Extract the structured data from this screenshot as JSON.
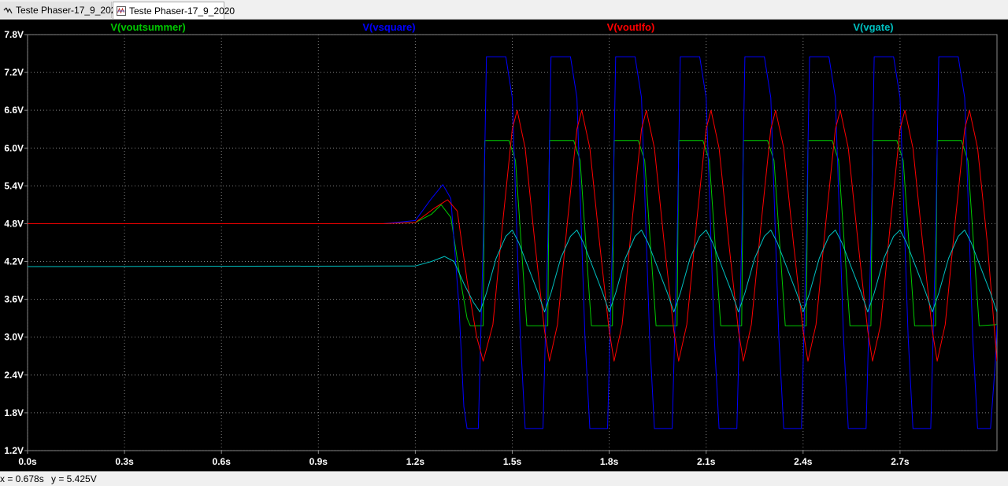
{
  "tabs": [
    {
      "label": "Teste Phaser-17_9_2020",
      "icon": "schematic-icon"
    },
    {
      "label": "Teste Phaser-17_9_2020",
      "icon": "waveform-icon",
      "active": true
    }
  ],
  "status": {
    "x_readout": "x = 0.678s",
    "y_readout": "y = 5.425V"
  },
  "chart_data": {
    "type": "line",
    "background": "#000000",
    "grid": true,
    "xlim": [
      0,
      3.0
    ],
    "ylim": [
      1.2,
      7.8
    ],
    "x_ticks": [
      0.0,
      0.3,
      0.6,
      0.9,
      1.2,
      1.5,
      1.8,
      2.1,
      2.4,
      2.7
    ],
    "x_tick_labels": [
      "0.0s",
      "0.3s",
      "0.6s",
      "0.9s",
      "1.2s",
      "1.5s",
      "1.8s",
      "2.1s",
      "2.4s",
      "2.7s"
    ],
    "y_ticks": [
      1.2,
      1.8,
      2.4,
      3.0,
      3.6,
      4.2,
      4.8,
      5.4,
      6.0,
      6.6,
      7.2,
      7.8
    ],
    "y_tick_labels": [
      "1.2V",
      "1.8V",
      "2.4V",
      "3.0V",
      "3.6V",
      "4.2V",
      "4.8V",
      "5.4V",
      "6.0V",
      "6.6V",
      "7.2V",
      "7.8V"
    ],
    "series": [
      {
        "name": "V(voutsummer)",
        "color": "#00c800",
        "points": [
          [
            0,
            4.8
          ],
          [
            1.1,
            4.8
          ],
          [
            1.2,
            4.82
          ],
          [
            1.25,
            4.95
          ],
          [
            1.28,
            5.1
          ],
          [
            1.31,
            4.9
          ],
          [
            1.34,
            3.9
          ],
          [
            1.36,
            3.3
          ],
          [
            1.37,
            3.18
          ],
          [
            1.41,
            3.18
          ],
          [
            1.415,
            6.12
          ],
          [
            1.49,
            6.12
          ],
          [
            1.51,
            5.8
          ],
          [
            1.545,
            3.18
          ],
          [
            1.61,
            3.18
          ],
          [
            1.615,
            6.12
          ],
          [
            1.69,
            6.12
          ],
          [
            1.71,
            5.8
          ],
          [
            1.745,
            3.18
          ],
          [
            1.81,
            3.18
          ],
          [
            1.815,
            6.12
          ],
          [
            1.89,
            6.12
          ],
          [
            1.91,
            5.8
          ],
          [
            1.945,
            3.18
          ],
          [
            2.01,
            3.18
          ],
          [
            2.015,
            6.12
          ],
          [
            2.09,
            6.12
          ],
          [
            2.11,
            5.8
          ],
          [
            2.145,
            3.18
          ],
          [
            2.21,
            3.18
          ],
          [
            2.215,
            6.12
          ],
          [
            2.29,
            6.12
          ],
          [
            2.31,
            5.8
          ],
          [
            2.345,
            3.18
          ],
          [
            2.41,
            3.18
          ],
          [
            2.415,
            6.12
          ],
          [
            2.49,
            6.12
          ],
          [
            2.51,
            5.8
          ],
          [
            2.545,
            3.18
          ],
          [
            2.61,
            3.18
          ],
          [
            2.615,
            6.12
          ],
          [
            2.69,
            6.12
          ],
          [
            2.71,
            5.8
          ],
          [
            2.745,
            3.18
          ],
          [
            2.81,
            3.18
          ],
          [
            2.815,
            6.12
          ],
          [
            2.89,
            6.12
          ],
          [
            2.91,
            5.8
          ],
          [
            2.945,
            3.18
          ],
          [
            3.0,
            3.2
          ]
        ]
      },
      {
        "name": "V(vsquare)",
        "color": "#0000ff",
        "points": [
          [
            0,
            4.8
          ],
          [
            1.1,
            4.8
          ],
          [
            1.2,
            4.85
          ],
          [
            1.25,
            5.2
          ],
          [
            1.285,
            5.42
          ],
          [
            1.31,
            5.2
          ],
          [
            1.335,
            3.5
          ],
          [
            1.35,
            1.9
          ],
          [
            1.36,
            1.55
          ],
          [
            1.395,
            1.55
          ],
          [
            1.41,
            4.5
          ],
          [
            1.42,
            7.45
          ],
          [
            1.48,
            7.45
          ],
          [
            1.5,
            6.8
          ],
          [
            1.525,
            3.0
          ],
          [
            1.54,
            1.55
          ],
          [
            1.595,
            1.55
          ],
          [
            1.61,
            4.5
          ],
          [
            1.62,
            7.45
          ],
          [
            1.68,
            7.45
          ],
          [
            1.7,
            6.8
          ],
          [
            1.725,
            3.0
          ],
          [
            1.74,
            1.55
          ],
          [
            1.795,
            1.55
          ],
          [
            1.81,
            4.5
          ],
          [
            1.82,
            7.45
          ],
          [
            1.88,
            7.45
          ],
          [
            1.9,
            6.8
          ],
          [
            1.925,
            3.0
          ],
          [
            1.94,
            1.55
          ],
          [
            1.995,
            1.55
          ],
          [
            2.01,
            4.5
          ],
          [
            2.02,
            7.45
          ],
          [
            2.08,
            7.45
          ],
          [
            2.1,
            6.8
          ],
          [
            2.125,
            3.0
          ],
          [
            2.14,
            1.55
          ],
          [
            2.195,
            1.55
          ],
          [
            2.21,
            4.5
          ],
          [
            2.22,
            7.45
          ],
          [
            2.28,
            7.45
          ],
          [
            2.3,
            6.8
          ],
          [
            2.325,
            3.0
          ],
          [
            2.34,
            1.55
          ],
          [
            2.395,
            1.55
          ],
          [
            2.41,
            4.5
          ],
          [
            2.42,
            7.45
          ],
          [
            2.48,
            7.45
          ],
          [
            2.5,
            6.8
          ],
          [
            2.525,
            3.0
          ],
          [
            2.54,
            1.55
          ],
          [
            2.595,
            1.55
          ],
          [
            2.61,
            4.5
          ],
          [
            2.62,
            7.45
          ],
          [
            2.68,
            7.45
          ],
          [
            2.7,
            6.8
          ],
          [
            2.725,
            3.0
          ],
          [
            2.74,
            1.55
          ],
          [
            2.795,
            1.55
          ],
          [
            2.81,
            4.5
          ],
          [
            2.82,
            7.45
          ],
          [
            2.88,
            7.45
          ],
          [
            2.9,
            6.8
          ],
          [
            2.925,
            3.0
          ],
          [
            2.94,
            1.55
          ],
          [
            2.98,
            1.55
          ],
          [
            2.995,
            2.6
          ],
          [
            3.0,
            3.2
          ]
        ]
      },
      {
        "name": "V(voutlfo)",
        "color": "#ff0000",
        "points": [
          [
            0,
            4.8
          ],
          [
            1.1,
            4.8
          ],
          [
            1.2,
            4.82
          ],
          [
            1.26,
            5.05
          ],
          [
            1.3,
            5.18
          ],
          [
            1.33,
            5.0
          ],
          [
            1.36,
            3.9
          ],
          [
            1.39,
            3.0
          ],
          [
            1.41,
            2.62
          ],
          [
            1.44,
            3.2
          ],
          [
            1.47,
            4.8
          ],
          [
            1.5,
            6.3
          ],
          [
            1.515,
            6.6
          ],
          [
            1.54,
            6.0
          ],
          [
            1.57,
            4.5
          ],
          [
            1.6,
            3.1
          ],
          [
            1.615,
            2.62
          ],
          [
            1.64,
            3.2
          ],
          [
            1.67,
            4.8
          ],
          [
            1.7,
            6.3
          ],
          [
            1.715,
            6.6
          ],
          [
            1.74,
            6.0
          ],
          [
            1.77,
            4.5
          ],
          [
            1.8,
            3.1
          ],
          [
            1.815,
            2.62
          ],
          [
            1.84,
            3.2
          ],
          [
            1.87,
            4.8
          ],
          [
            1.9,
            6.3
          ],
          [
            1.915,
            6.6
          ],
          [
            1.94,
            6.0
          ],
          [
            1.97,
            4.5
          ],
          [
            2.0,
            3.1
          ],
          [
            2.015,
            2.62
          ],
          [
            2.04,
            3.2
          ],
          [
            2.07,
            4.8
          ],
          [
            2.1,
            6.3
          ],
          [
            2.115,
            6.6
          ],
          [
            2.14,
            6.0
          ],
          [
            2.17,
            4.5
          ],
          [
            2.2,
            3.1
          ],
          [
            2.215,
            2.62
          ],
          [
            2.24,
            3.2
          ],
          [
            2.27,
            4.8
          ],
          [
            2.3,
            6.3
          ],
          [
            2.315,
            6.6
          ],
          [
            2.34,
            6.0
          ],
          [
            2.37,
            4.5
          ],
          [
            2.4,
            3.1
          ],
          [
            2.415,
            2.62
          ],
          [
            2.44,
            3.2
          ],
          [
            2.47,
            4.8
          ],
          [
            2.5,
            6.3
          ],
          [
            2.515,
            6.6
          ],
          [
            2.54,
            6.0
          ],
          [
            2.57,
            4.5
          ],
          [
            2.6,
            3.1
          ],
          [
            2.615,
            2.62
          ],
          [
            2.64,
            3.2
          ],
          [
            2.67,
            4.8
          ],
          [
            2.7,
            6.3
          ],
          [
            2.715,
            6.6
          ],
          [
            2.74,
            6.0
          ],
          [
            2.77,
            4.5
          ],
          [
            2.8,
            3.1
          ],
          [
            2.815,
            2.62
          ],
          [
            2.84,
            3.2
          ],
          [
            2.87,
            4.8
          ],
          [
            2.9,
            6.3
          ],
          [
            2.915,
            6.6
          ],
          [
            2.94,
            6.0
          ],
          [
            2.97,
            4.5
          ],
          [
            3.0,
            2.62
          ]
        ]
      },
      {
        "name": "V(vgate)",
        "color": "#00c0c0",
        "points": [
          [
            0,
            4.12
          ],
          [
            1.2,
            4.13
          ],
          [
            1.25,
            4.2
          ],
          [
            1.29,
            4.28
          ],
          [
            1.32,
            4.2
          ],
          [
            1.35,
            3.85
          ],
          [
            1.38,
            3.55
          ],
          [
            1.4,
            3.4
          ],
          [
            1.42,
            3.7
          ],
          [
            1.45,
            4.25
          ],
          [
            1.48,
            4.6
          ],
          [
            1.5,
            4.7
          ],
          [
            1.52,
            4.5
          ],
          [
            1.55,
            4.1
          ],
          [
            1.58,
            3.7
          ],
          [
            1.6,
            3.4
          ],
          [
            1.62,
            3.7
          ],
          [
            1.65,
            4.25
          ],
          [
            1.68,
            4.6
          ],
          [
            1.7,
            4.7
          ],
          [
            1.72,
            4.5
          ],
          [
            1.75,
            4.1
          ],
          [
            1.78,
            3.7
          ],
          [
            1.8,
            3.4
          ],
          [
            1.82,
            3.7
          ],
          [
            1.85,
            4.25
          ],
          [
            1.88,
            4.6
          ],
          [
            1.9,
            4.7
          ],
          [
            1.92,
            4.5
          ],
          [
            1.95,
            4.1
          ],
          [
            1.98,
            3.7
          ],
          [
            2.0,
            3.4
          ],
          [
            2.02,
            3.7
          ],
          [
            2.05,
            4.25
          ],
          [
            2.08,
            4.6
          ],
          [
            2.1,
            4.7
          ],
          [
            2.12,
            4.5
          ],
          [
            2.15,
            4.1
          ],
          [
            2.18,
            3.7
          ],
          [
            2.2,
            3.4
          ],
          [
            2.22,
            3.7
          ],
          [
            2.25,
            4.25
          ],
          [
            2.28,
            4.6
          ],
          [
            2.3,
            4.7
          ],
          [
            2.32,
            4.5
          ],
          [
            2.35,
            4.1
          ],
          [
            2.38,
            3.7
          ],
          [
            2.4,
            3.4
          ],
          [
            2.42,
            3.7
          ],
          [
            2.45,
            4.25
          ],
          [
            2.48,
            4.6
          ],
          [
            2.5,
            4.7
          ],
          [
            2.52,
            4.5
          ],
          [
            2.55,
            4.1
          ],
          [
            2.58,
            3.7
          ],
          [
            2.6,
            3.4
          ],
          [
            2.62,
            3.7
          ],
          [
            2.65,
            4.25
          ],
          [
            2.68,
            4.6
          ],
          [
            2.7,
            4.7
          ],
          [
            2.72,
            4.5
          ],
          [
            2.75,
            4.1
          ],
          [
            2.78,
            3.7
          ],
          [
            2.8,
            3.4
          ],
          [
            2.82,
            3.7
          ],
          [
            2.85,
            4.25
          ],
          [
            2.88,
            4.6
          ],
          [
            2.9,
            4.7
          ],
          [
            2.92,
            4.5
          ],
          [
            2.95,
            4.1
          ],
          [
            2.98,
            3.7
          ],
          [
            3.0,
            3.4
          ]
        ]
      }
    ]
  }
}
